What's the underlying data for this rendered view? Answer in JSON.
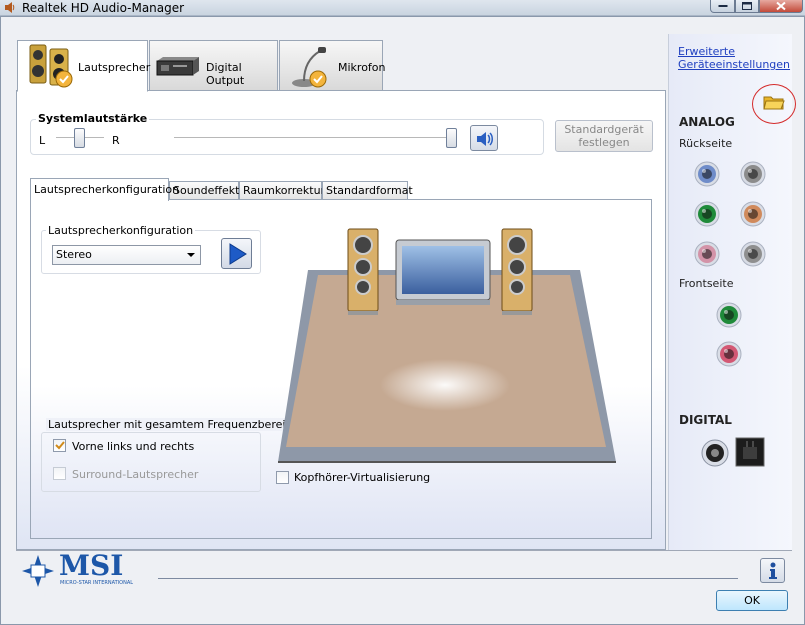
{
  "window": {
    "title": "Realtek HD Audio-Manager"
  },
  "device_tabs": [
    {
      "label": "Lautsprecher",
      "icon": "speaker-icon",
      "active": true
    },
    {
      "label": "Digital Output",
      "icon": "digital-output-icon",
      "active": false
    },
    {
      "label": "Mikrofon",
      "icon": "microphone-icon",
      "active": false
    }
  ],
  "volume": {
    "title": "Systemlautstärke",
    "left_label": "L",
    "right_label": "R",
    "balance": 0.5,
    "level": 1.0
  },
  "default_device_button": "Standardgerät festlegen",
  "sub_tabs": [
    {
      "label": "Lautsprecherkonfiguration",
      "active": true
    },
    {
      "label": "Soundeffekt",
      "active": false
    },
    {
      "label": "Raumkorrektur",
      "active": false
    },
    {
      "label": "Standardformat",
      "active": false
    }
  ],
  "speaker_config": {
    "group_title": "Lautsprecherkonfiguration",
    "selected": "Stereo"
  },
  "full_range": {
    "group_title": "Lautsprecher mit gesamtem Frequenzbereich",
    "front_label": "Vorne links und rechts",
    "front_checked": true,
    "surround_label": "Surround-Lautsprecher",
    "surround_enabled": false
  },
  "headphone_virtualization": {
    "label": "Kopfhörer-Virtualisierung",
    "checked": false
  },
  "right_panel": {
    "advanced_link_line1": "Erweiterte",
    "advanced_link_line2": "Geräteeinstellungen",
    "analog_title": "ANALOG",
    "rear_label": "Rückseite",
    "front_label": "Frontseite",
    "digital_title": "DIGITAL"
  },
  "jack_colors": {
    "rear": [
      "#6f8cc9",
      "#8c8c8c",
      "#1f8a3a",
      "#d08a5c",
      "#d393a8",
      "#8f8f8f"
    ],
    "front": [
      "#1f8a3a",
      "#d35874"
    ]
  },
  "footer": {
    "brand": "MSI",
    "brand_sub": "MICRO-STAR INTERNATIONAL",
    "ok_label": "OK"
  }
}
